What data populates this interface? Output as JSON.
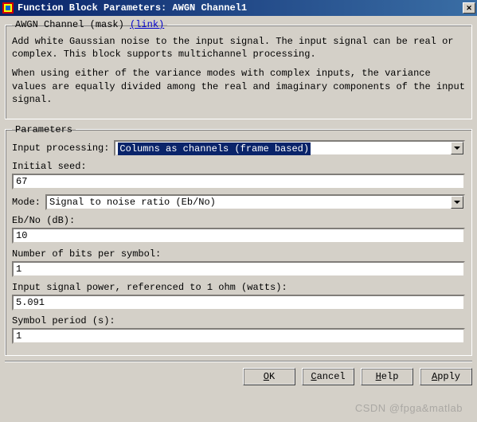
{
  "titlebar": {
    "title": "Function Block Parameters: AWGN Channel1"
  },
  "mask_group": {
    "legend_plain": "AWGN Channel (mask) ",
    "legend_link": "(link)",
    "description_p1": "Add white Gaussian noise to the input signal. The input signal can be real or complex. This block supports multichannel processing.",
    "description_p2": "When using either of the variance modes with complex inputs, the variance values are equally divided among the real and imaginary components of the input signal."
  },
  "parameters": {
    "legend": "Parameters",
    "input_processing": {
      "label": "Input processing:",
      "value": "Columns as channels (frame based)"
    },
    "initial_seed": {
      "label": "Initial seed:",
      "value": "67"
    },
    "mode": {
      "label": "Mode:",
      "value": "Signal to noise ratio  (Eb/No)"
    },
    "ebno": {
      "label": "Eb/No (dB):",
      "value": "10"
    },
    "bits_per_symbol": {
      "label": "Number of bits per symbol:",
      "value": "1"
    },
    "input_power": {
      "label": "Input signal power, referenced to 1 ohm (watts):",
      "value": "5.091"
    },
    "symbol_period": {
      "label": "Symbol period (s):",
      "value": "1"
    }
  },
  "buttons": {
    "ok": "OK",
    "cancel": "Cancel",
    "help": "Help",
    "apply": "Apply"
  },
  "watermark": "CSDN @fpga&matlab"
}
